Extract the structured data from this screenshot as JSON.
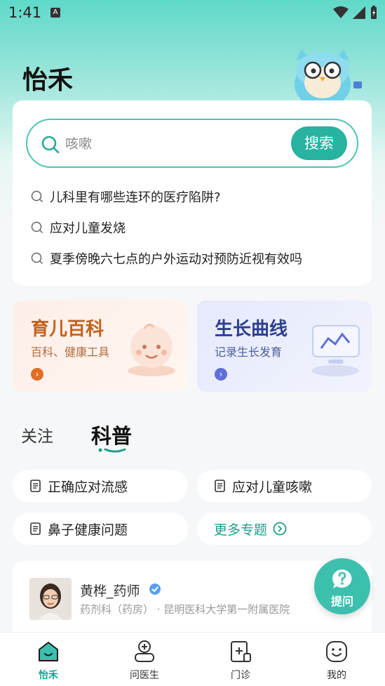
{
  "status_bar": {
    "time": "1:41",
    "notification_badge": "A"
  },
  "header": {
    "title": "怡禾"
  },
  "search": {
    "placeholder": "咳嗽",
    "button_label": "搜索",
    "suggestions": [
      "儿科里有哪些连环的医疗陷阱?",
      "应对儿童发烧",
      "夏季傍晚六七点的户外运动对预防近视有效吗"
    ]
  },
  "features": [
    {
      "title": "育儿百科",
      "subtitle": "百科、健康工具",
      "icon": "baby-face-icon",
      "accent": "#e16d24"
    },
    {
      "title": "生长曲线",
      "subtitle": "记录生长发育",
      "icon": "growth-chart-monitor-icon",
      "accent": "#5f6fd6"
    }
  ],
  "tabs": {
    "follow": "关注",
    "science": "科普",
    "active": "科普"
  },
  "topics": [
    {
      "label": "正确应对流感",
      "icon": "document-icon"
    },
    {
      "label": "应对儿童咳嗽",
      "icon": "document-icon"
    },
    {
      "label": "鼻子健康问题",
      "icon": "document-icon"
    },
    {
      "label": "更多专题",
      "icon": "chevron-right-circle-icon"
    }
  ],
  "doctor": {
    "name": "黄桦_药师",
    "department": "药剂科（药房） · 昆明医科大学第一附属医院"
  },
  "ask_button": {
    "label": "提问"
  },
  "bottom_nav": [
    {
      "label": "怡禾",
      "active": true,
      "icon": "home-icon"
    },
    {
      "label": "问医生",
      "active": false,
      "icon": "doctor-icon"
    },
    {
      "label": "门诊",
      "active": false,
      "icon": "clinic-icon"
    },
    {
      "label": "我的",
      "active": false,
      "icon": "smiley-profile-icon"
    }
  ],
  "colors": {
    "brand": "#27b3a0",
    "background": "#f6f7f9"
  }
}
